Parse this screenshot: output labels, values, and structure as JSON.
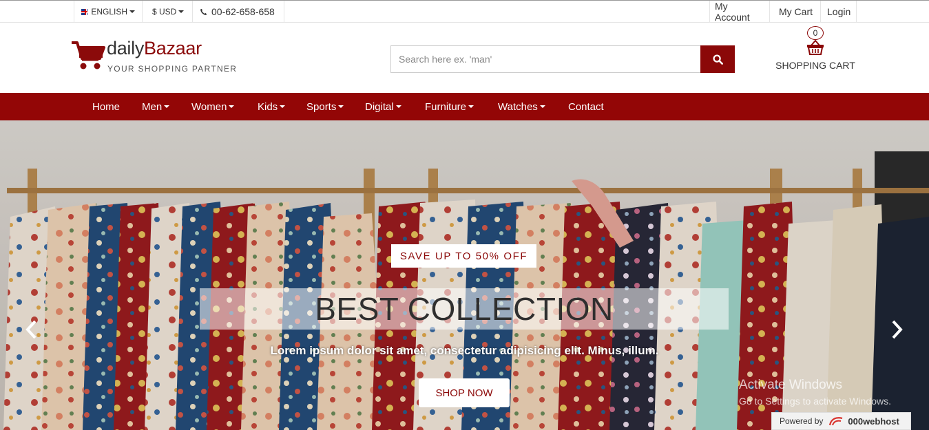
{
  "topbar": {
    "language": "ENGLISH",
    "currency": "$ USD",
    "phone": "00-62-658-658",
    "my_account": "My Account",
    "my_cart": "My Cart",
    "login": "Login"
  },
  "header": {
    "logo_prefix": "daily",
    "logo_suffix": "Bazaar",
    "tagline": "YOUR SHOPPING PARTNER",
    "search_placeholder": "Search here ex. 'man'",
    "cart_count": "0",
    "cart_label": "SHOPPING CART"
  },
  "nav": {
    "items": [
      {
        "label": "Home",
        "dropdown": false
      },
      {
        "label": "Men",
        "dropdown": true
      },
      {
        "label": "Women",
        "dropdown": true
      },
      {
        "label": "Kids",
        "dropdown": true
      },
      {
        "label": "Sports",
        "dropdown": true
      },
      {
        "label": "Digital",
        "dropdown": true
      },
      {
        "label": "Furniture",
        "dropdown": true
      },
      {
        "label": "Watches",
        "dropdown": true
      },
      {
        "label": "Contact",
        "dropdown": false
      }
    ]
  },
  "hero": {
    "badge": "SAVE UP TO 50% OFF",
    "title": "BEST COLLECTION",
    "subtitle": "Lorem ipsum dolor sit amet, consectetur adipisicing elit. Minus, illum.",
    "cta": "SHOP NOW"
  },
  "overlay": {
    "activate_title": "Activate Windows",
    "activate_sub": "Go to Settings to activate Windows.",
    "powered_by": "Powered by",
    "host_name": "000webhost"
  },
  "colors": {
    "brand": "#930606",
    "button": "#8b0808"
  }
}
